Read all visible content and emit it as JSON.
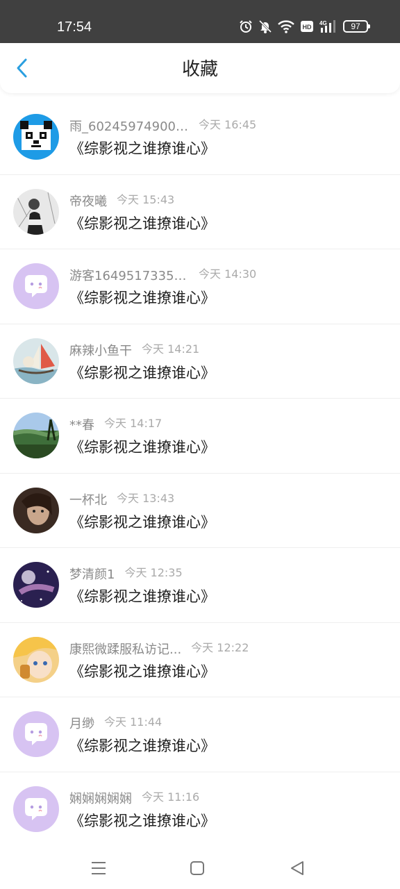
{
  "status_bar": {
    "time": "17:54",
    "battery": "97",
    "icons": [
      "alarm-icon",
      "mute-icon",
      "wifi-icon",
      "hd-icon",
      "4g-signal-icon",
      "battery-icon"
    ]
  },
  "header": {
    "title": "收藏",
    "back_icon": "chevron-left-icon"
  },
  "colors": {
    "accent": "#2a9fe0",
    "default_avatar_bg": "#d7c3f2",
    "divider": "#eeeeee"
  },
  "items": [
    {
      "username": "雨_602459749001...",
      "time": "今天 16:45",
      "title": "《综影视之谁撩谁心》",
      "avatar": "panda"
    },
    {
      "username": "帝夜曦",
      "time": "今天 15:43",
      "title": "《综影视之谁撩谁心》",
      "avatar": "sketch"
    },
    {
      "username": "游客16495173351...",
      "time": "今天 14:30",
      "title": "《综影视之谁撩谁心》",
      "avatar": "default"
    },
    {
      "username": "麻辣小鱼干",
      "time": "今天 14:21",
      "title": "《综影视之谁撩谁心》",
      "avatar": "boat"
    },
    {
      "username": "**春",
      "time": "今天 14:17",
      "title": "《综影视之谁撩谁心》",
      "avatar": "landscape"
    },
    {
      "username": "一杯北",
      "time": "今天 13:43",
      "title": "《综影视之谁撩谁心》",
      "avatar": "portrait"
    },
    {
      "username": "梦清颜1",
      "time": "今天 12:35",
      "title": "《综影视之谁撩谁心》",
      "avatar": "galaxy"
    },
    {
      "username": "康熙微蹂服私访记...",
      "time": "今天 12:22",
      "title": "《综影视之谁撩谁心》",
      "avatar": "anime"
    },
    {
      "username": "月缈",
      "time": "今天 11:44",
      "title": "《综影视之谁撩谁心》",
      "avatar": "default"
    },
    {
      "username": "娴娴娴娴娴",
      "time": "今天 11:16",
      "title": "《综影视之谁撩谁心》",
      "avatar": "default"
    }
  ],
  "nav_bar": {
    "icons": [
      "menu-icon",
      "home-square-icon",
      "back-triangle-icon"
    ]
  }
}
